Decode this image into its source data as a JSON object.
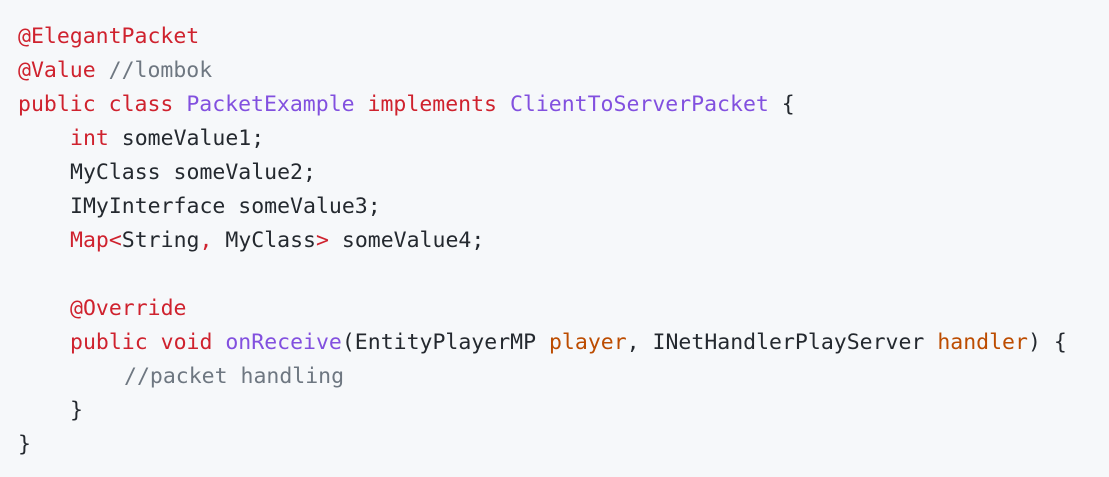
{
  "code": {
    "l1": {
      "ann": "@ElegantPacket"
    },
    "l2": {
      "ann": "@Value",
      "comment": "//lombok"
    },
    "l3": {
      "kw1": "public",
      "kw2": "class",
      "name": "PacketExample",
      "kw3": "implements",
      "iface": "ClientToServerPacket",
      "brace": "{"
    },
    "l4": {
      "type": "int",
      "rest": "someValue1;"
    },
    "l5": {
      "text": "MyClass someValue2;"
    },
    "l6": {
      "text": "IMyInterface someValue3;"
    },
    "l7": {
      "type": "Map",
      "lt": "<",
      "t1": "String",
      "comma": ",",
      "t2": "MyClass",
      "gt": ">",
      "rest": "someValue4;"
    },
    "l9": {
      "ann": "@Override"
    },
    "l10": {
      "kw1": "public",
      "kw2": "void",
      "fn": "onReceive",
      "open": "(EntityPlayerMP",
      "p1": "player",
      "mid": ", INetHandlerPlayServer",
      "p2": "handler",
      "close": ") {"
    },
    "l11": {
      "comment": "//packet handling"
    },
    "l12": {
      "brace": "}"
    },
    "l13": {
      "brace": "}"
    }
  }
}
